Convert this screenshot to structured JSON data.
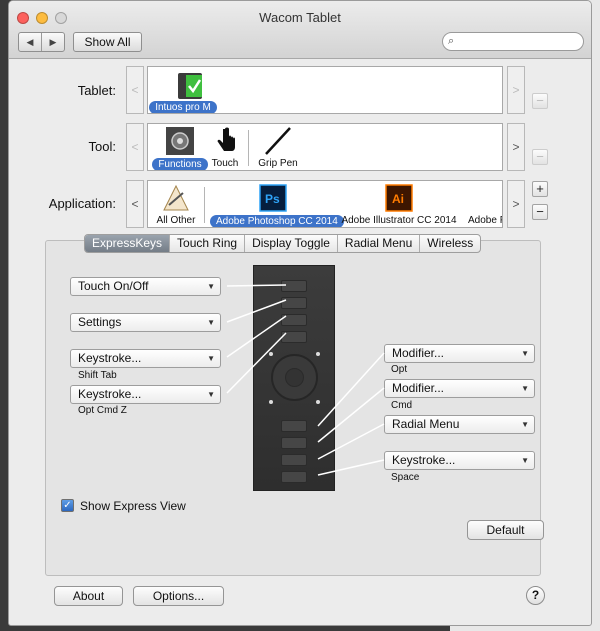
{
  "window": {
    "title": "Wacom Tablet"
  },
  "toolbar": {
    "back_icon": "back-arrow-icon",
    "forward_icon": "forward-arrow-icon",
    "show_all": "Show All",
    "search_placeholder": "",
    "search_icon": "magnifier-icon"
  },
  "rows": {
    "tablet": {
      "label": "Tablet:",
      "items": [
        {
          "label": "Intuos pro M",
          "selected": true
        }
      ]
    },
    "tool": {
      "label": "Tool:",
      "items": [
        {
          "label": "Functions",
          "selected": true
        },
        {
          "label": "Touch",
          "selected": false
        },
        {
          "label": "Grip Pen",
          "selected": false
        }
      ]
    },
    "application": {
      "label": "Application:",
      "items": [
        {
          "label": "All Other",
          "selected": false
        },
        {
          "label": "Adobe Photoshop CC 2014",
          "selected": true
        },
        {
          "label": "Adobe Illustrator CC 2014",
          "selected": false
        },
        {
          "label": "Adobe P",
          "selected": false
        }
      ]
    }
  },
  "row_buttons": {
    "add": "+",
    "remove": "−",
    "scroll_left": "<",
    "scroll_right": ">"
  },
  "tabs": [
    "ExpressKeys",
    "Touch Ring",
    "Display Toggle",
    "Radial Menu",
    "Wireless"
  ],
  "selected_tab": "ExpressKeys",
  "left_keys": [
    {
      "value": "Touch On/Off",
      "sub": ""
    },
    {
      "value": "Settings",
      "sub": ""
    },
    {
      "value": "Keystroke...",
      "sub": "Shift Tab"
    },
    {
      "value": "Keystroke...",
      "sub": "Opt Cmd Z"
    }
  ],
  "right_keys": [
    {
      "value": "Modifier...",
      "sub": "Opt"
    },
    {
      "value": "Modifier...",
      "sub": "Cmd"
    },
    {
      "value": "Radial Menu",
      "sub": ""
    },
    {
      "value": "Keystroke...",
      "sub": "Space"
    }
  ],
  "show_express_view": {
    "label": "Show Express View",
    "checked": true
  },
  "buttons": {
    "default": "Default",
    "about": "About",
    "options": "Options...",
    "help": "?"
  },
  "colors": {
    "accent": "#3d73c9",
    "traffic_close": "#fc615d",
    "traffic_min": "#fdbc40",
    "traffic_zoom": "#34c84a"
  }
}
